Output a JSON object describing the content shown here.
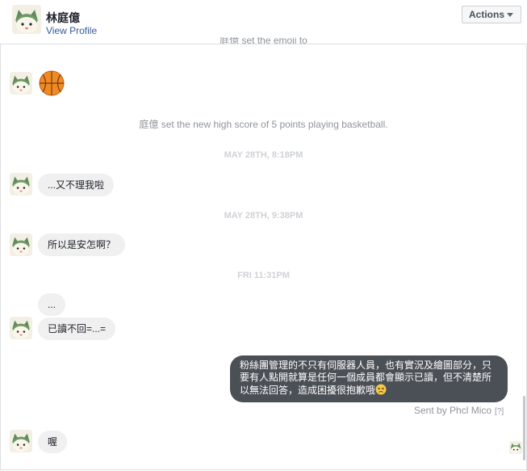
{
  "header": {
    "name": "林庭億",
    "view_profile": "View Profile",
    "actions": "Actions"
  },
  "messages": {
    "cut_off_system": "庭億 set the emoji to",
    "system_high_score": "庭億 set the new high score of 5 points playing basketball.",
    "ts1": "MAY 28TH, 8:18PM",
    "bubble1": "...又不理我啦",
    "ts2": "MAY 28TH, 9:38PM",
    "bubble2": "所以是安怎啊？",
    "ts3": "FRI 11:31PM",
    "bubble3a": "...",
    "bubble3b": "已讀不回=...=",
    "outgoing": "粉絲團管理的不只有伺服器人員，也有實況及繪圖部分，只要有人點開就算是任何一個成員都會顯示已讀，但不清楚所以無法回答，造成困擾很抱歉哦",
    "sent_by": "Sent by Phcl Mico",
    "sent_by_help": "[?]",
    "bubble4": "喔"
  },
  "colors": {
    "link": "#365899",
    "outgoing_bubble": "#4b4f56",
    "incoming_bubble": "#f1f0f0"
  },
  "icons": {
    "avatar": "cat-avatar-icon",
    "basketball": "basketball-emoji-icon",
    "caret": "caret-down-icon",
    "persevering": "persevering-face-emoji-icon"
  }
}
